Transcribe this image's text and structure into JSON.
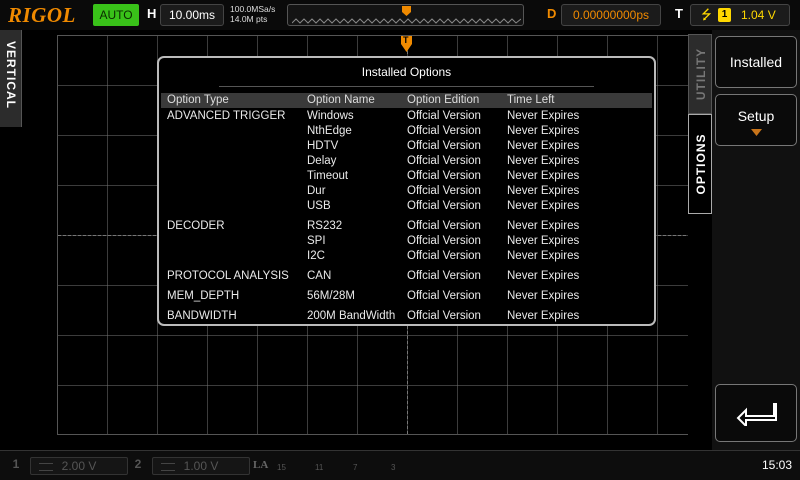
{
  "topbar": {
    "logo": "RIGOL",
    "run_state": "AUTO",
    "horizontal_label": "H",
    "timebase": "10.00ms",
    "sample_rate": "100.0MSa/s",
    "memory_depth": "14.0M pts",
    "delay_label": "D",
    "delay_value": "0.00000000ps",
    "trigger_label": "T",
    "trigger_source": "1",
    "trigger_level": "1.04 V"
  },
  "left_tab": {
    "label": "VERTICAL"
  },
  "dialog": {
    "title": "Installed Options",
    "headers": [
      "Option Type",
      "Option Name",
      "Option Edition",
      "Time Left"
    ],
    "rows": [
      {
        "type": "ADVANCED TRIGGER",
        "name": "Windows",
        "edition": "Offcial Version",
        "time_left": "Never Expires"
      },
      {
        "type": "",
        "name": "NthEdge",
        "edition": "Offcial Version",
        "time_left": "Never Expires"
      },
      {
        "type": "",
        "name": "HDTV",
        "edition": "Offcial Version",
        "time_left": "Never Expires"
      },
      {
        "type": "",
        "name": "Delay",
        "edition": "Offcial Version",
        "time_left": "Never Expires"
      },
      {
        "type": "",
        "name": "Timeout",
        "edition": "Offcial Version",
        "time_left": "Never Expires"
      },
      {
        "type": "",
        "name": "Dur",
        "edition": "Offcial Version",
        "time_left": "Never Expires"
      },
      {
        "type": "",
        "name": "USB",
        "edition": "Offcial Version",
        "time_left": "Never Expires"
      },
      {
        "type": "DECODER",
        "name": "RS232",
        "edition": "Offcial Version",
        "time_left": "Never Expires"
      },
      {
        "type": "",
        "name": "SPI",
        "edition": "Offcial Version",
        "time_left": "Never Expires"
      },
      {
        "type": "",
        "name": "I2C",
        "edition": "Offcial Version",
        "time_left": "Never Expires"
      },
      {
        "type": "PROTOCOL ANALYSIS",
        "name": "CAN",
        "edition": "Offcial Version",
        "time_left": "Never Expires"
      },
      {
        "type": "MEM_DEPTH",
        "name": "56M/28M",
        "edition": "Offcial Version",
        "time_left": "Never Expires"
      },
      {
        "type": "BANDWIDTH",
        "name": "200M BandWidth",
        "edition": "Offcial Version",
        "time_left": "Never Expires"
      }
    ]
  },
  "right_tabs": {
    "utility": "UTILITY",
    "options": "OPTIONS"
  },
  "menu": {
    "installed": "Installed",
    "setup": "Setup"
  },
  "bottombar": {
    "ch1_num": "1",
    "ch1_scale": "2.00 V",
    "ch2_num": "2",
    "ch2_scale": "1.00 V",
    "la_label": "LA",
    "la_channels": [
      "15",
      "11",
      "7",
      "3"
    ],
    "time": "15:03"
  },
  "colors": {
    "accent": "#f08a00",
    "run_green": "#39c219",
    "trigger_yellow": "#ffd800"
  }
}
